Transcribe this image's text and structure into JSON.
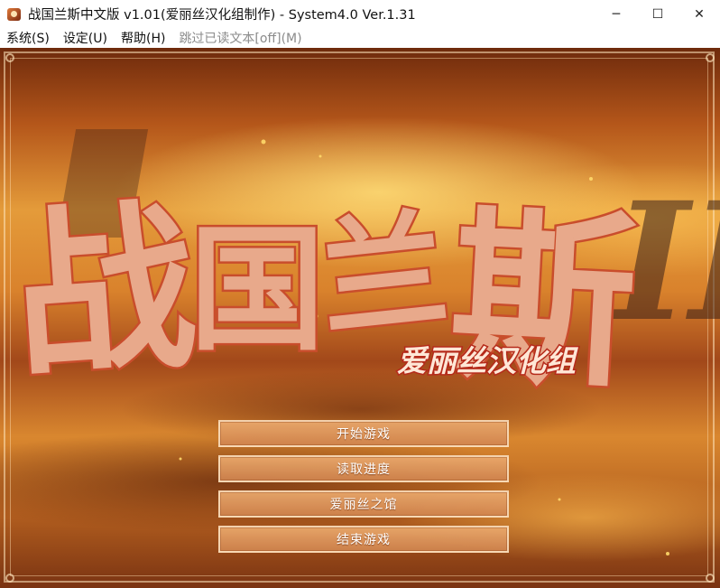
{
  "window": {
    "title": "战国兰斯中文版 v1.01(爱丽丝汉化组制作) - System4.0 Ver.1.31",
    "icon": "game-app-icon",
    "minimize_glyph": "─",
    "maximize_glyph": "☐",
    "close_glyph": "✕"
  },
  "menubar": {
    "items": [
      "系统(S)",
      "设定(U)",
      "帮助(H)",
      "跳过已读文本[off](M)"
    ]
  },
  "game": {
    "logo_title_chars": [
      "战",
      "国",
      "兰",
      "斯"
    ],
    "logo_subtitle": "爱丽丝汉化组",
    "logo_shadow_text": "III",
    "menu": [
      "开始游戏",
      "读取进度",
      "爱丽丝之馆",
      "结束游戏"
    ]
  },
  "colors": {
    "logo_fill": "#e8a98b",
    "logo_outline": "#c94d2c",
    "logo_shadow": "#3a2018",
    "button_text": "#ffffff"
  }
}
